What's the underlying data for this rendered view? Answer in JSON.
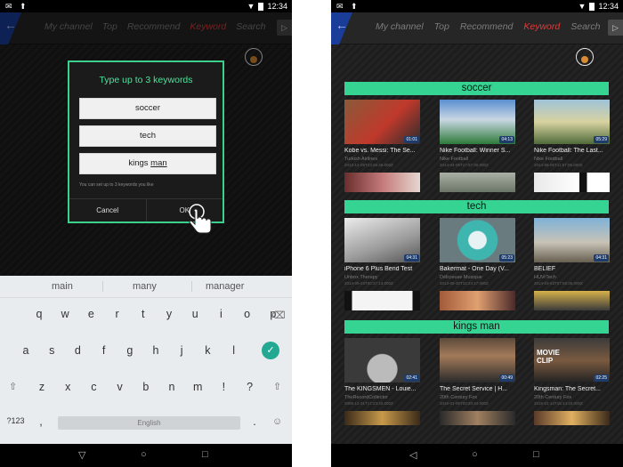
{
  "left": {
    "status": {
      "time": "12:34"
    },
    "nav": {
      "tabs": [
        "My channel",
        "Top",
        "Recommend",
        "Keyword",
        "Search"
      ],
      "active": "Keyword"
    },
    "dialog": {
      "title": "Type up to 3 keywords",
      "keywords": [
        "soccer",
        "tech",
        "kings"
      ],
      "keyword3_underlined": "man",
      "hint": "You can set up to 3 keywords you like",
      "cancel": "Cancel",
      "ok": "OK"
    },
    "keyboard": {
      "suggestions": [
        "main",
        "many",
        "manager"
      ],
      "row1": [
        "q",
        "w",
        "e",
        "r",
        "t",
        "y",
        "u",
        "i",
        "o",
        "p"
      ],
      "row2": [
        "a",
        "s",
        "d",
        "f",
        "g",
        "h",
        "j",
        "k",
        "l"
      ],
      "row3": [
        "z",
        "x",
        "c",
        "v",
        "b",
        "n",
        "m",
        "!",
        "?"
      ],
      "symbols": "?123",
      "comma": ",",
      "space": "English",
      "period": "."
    }
  },
  "right": {
    "status": {
      "time": "12:34"
    },
    "nav": {
      "tabs": [
        "My channel",
        "Top",
        "Recommend",
        "Keyword",
        "Search"
      ],
      "active": "Keyword"
    },
    "sections": [
      {
        "title": "soccer",
        "videos": [
          {
            "title": "Kobe vs. Messi: The Se...",
            "channel": "Turkish Airlines",
            "date": "2013-12-09T23:26:46.000Z",
            "duration": "01:01"
          },
          {
            "title": "Nike Football: Winner S...",
            "channel": "Nike Football",
            "date": "2014-04-05T17:57:30.000Z",
            "duration": "04:13"
          },
          {
            "title": "Nike Football: The Last...",
            "channel": "Nike Football",
            "date": "2014-06-05T11:57:05.000Z",
            "duration": "05:29"
          }
        ]
      },
      {
        "title": "tech",
        "videos": [
          {
            "title": "iPhone 6 Plus Bend Test",
            "channel": "Unbox Therapy",
            "date": "2014-09-23T00:37:13.000Z",
            "duration": "04:31"
          },
          {
            "title": "Bakermat - One Day (V...",
            "channel": "Délicieuse Musique",
            "date": "2013-06-30T12:24:17.000Z",
            "duration": "05:23"
          },
          {
            "title": "BELIEF",
            "channel": "HUVrTech",
            "date": "2014-03-03T07:59:36.000Z",
            "duration": "04:31"
          }
        ]
      },
      {
        "title": "kings man",
        "videos": [
          {
            "title": "The KINGSMEN - Louie...",
            "channel": "TheRecordCollector",
            "date": "2006-12-31T17:23:33.000Z",
            "duration": "02:41"
          },
          {
            "title": "The Secret Service | H...",
            "channel": "20th Century Fox",
            "date": "2015-01-05T03:20:44.000Z",
            "duration": "00:49"
          },
          {
            "title": "Kingsman: The Secret...",
            "channel": "20th Century Fox",
            "date": "2015-01-14T15:14:33.000Z",
            "duration": "02:25"
          }
        ]
      }
    ],
    "thumb_overlay": "MOVIE CLIP"
  }
}
